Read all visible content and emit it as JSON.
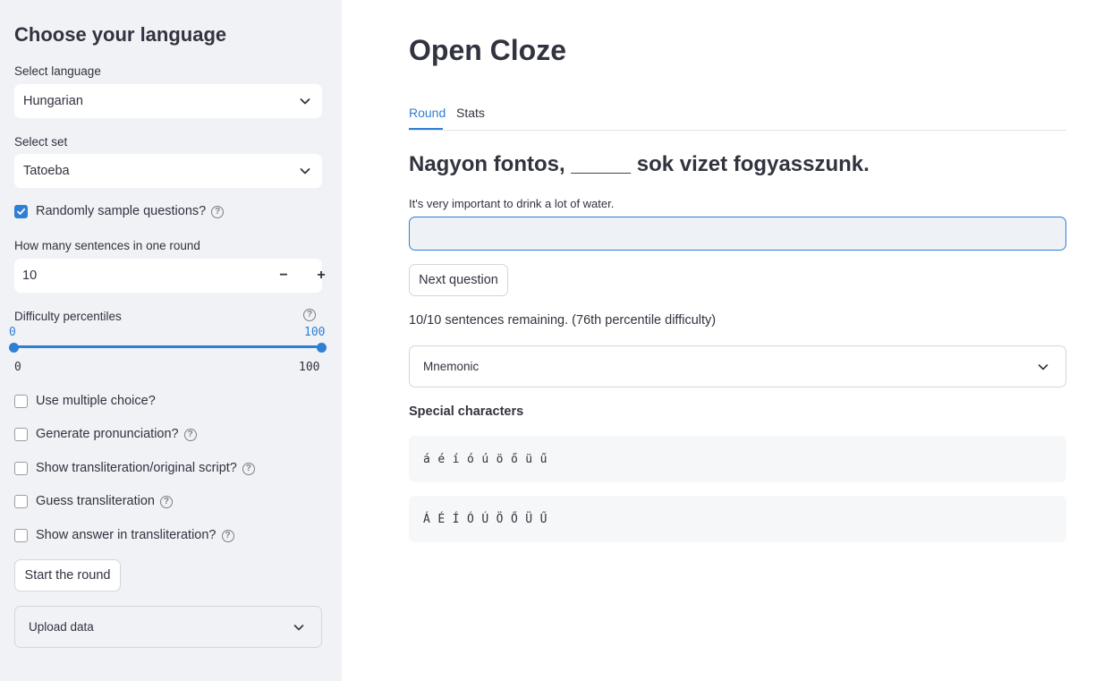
{
  "sidebar": {
    "title": "Choose your language",
    "language_label": "Select language",
    "language_value": "Hungarian",
    "set_label": "Select set",
    "set_value": "Tatoeba",
    "random_sample_label": "Randomly sample questions?",
    "random_sample_checked": true,
    "sentences_label": "How many sentences in one round",
    "sentences_value": "10",
    "minus_label": "−",
    "plus_label": "+",
    "difficulty_label": "Difficulty percentiles",
    "difficulty_low": "0",
    "difficulty_high": "100",
    "difficulty_min": "0",
    "difficulty_max": "100",
    "multiple_choice_label": "Use multiple choice?",
    "pronunciation_label": "Generate pronunciation?",
    "transliteration_label": "Show transliteration/original script?",
    "guess_transliteration_label": "Guess transliteration",
    "answer_transliteration_label": "Show answer in transliteration?",
    "start_button": "Start the round",
    "upload_label": "Upload data",
    "help_glyph": "?"
  },
  "main": {
    "title": "Open Cloze",
    "tabs": [
      {
        "label": "Round",
        "active": true
      },
      {
        "label": "Stats",
        "active": false
      }
    ],
    "question": "Nagyon fontos, _____ sok vizet fogyasszunk.",
    "translation": "It's very important to drink a lot of water.",
    "answer_value": "",
    "next_button": "Next question",
    "status": "10/10 sentences remaining. (76th percentile difficulty)",
    "mnemonic_label": "Mnemonic",
    "special_title": "Special characters",
    "lowercase_chars": [
      "á",
      "é",
      "í",
      "ó",
      "ú",
      "ö",
      "ő",
      "ü",
      "ű"
    ],
    "uppercase_chars": [
      "Á",
      "É",
      "Í",
      "Ó",
      "Ú",
      "Ö",
      "Ő",
      "Ü",
      "Ű"
    ]
  },
  "colors": {
    "accent": "#2f7fd3",
    "sidebar_bg": "#f0f2f6",
    "text": "#31333f"
  }
}
